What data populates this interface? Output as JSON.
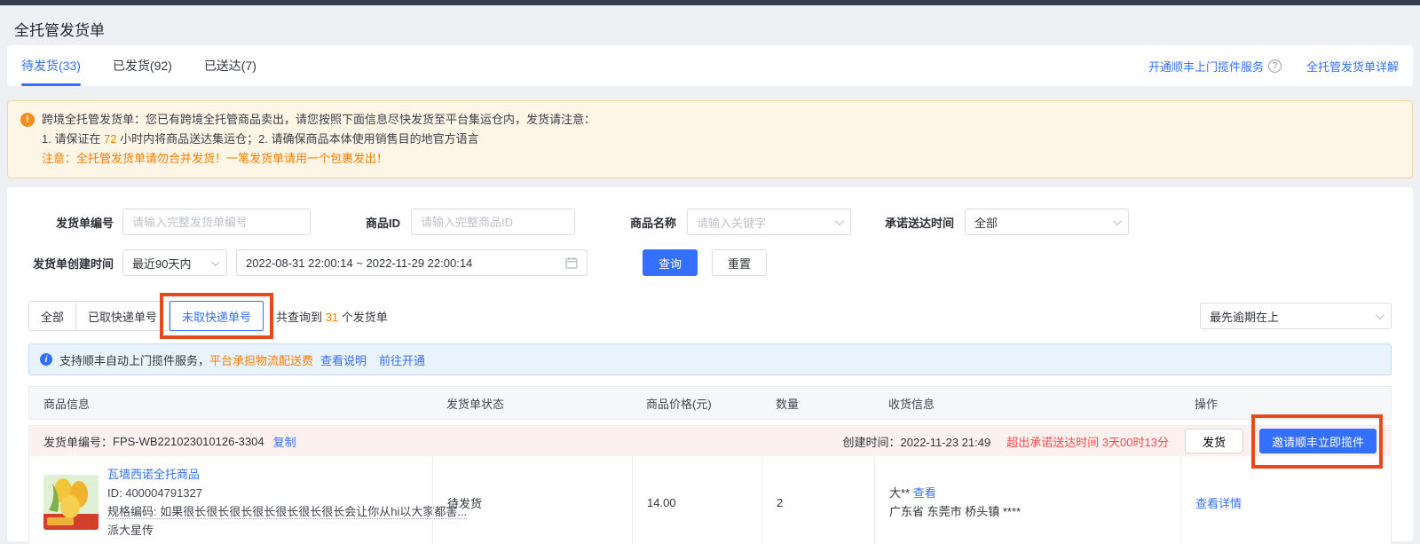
{
  "colors": {
    "accent": "#3370ff",
    "orange": "#fa7d00",
    "danger": "#fb4a4a",
    "annotation": "#e8491c"
  },
  "icons": {
    "help": "?",
    "warning": "!",
    "info": "i"
  },
  "page": {
    "title": "全托管发货单"
  },
  "tabs": [
    {
      "label": "待发货(33)"
    },
    {
      "label": "已发货(92)"
    },
    {
      "label": "已送达(7)"
    }
  ],
  "toplinks": {
    "sf_service": "开通顺丰上门揽件服务",
    "detail": "全托管发货单详解"
  },
  "notice": {
    "line1": "跨境全托管发货单：您已有跨境全托管商品卖出，请您按照下面信息尽快发货至平台集运仓内，发货请注意：",
    "line2_pre": "1. 请保证在 ",
    "line2_hl": "72",
    "line2_post": " 小时内将商品送达集运仓；2. 请确保商品本体使用销售目的地官方语言",
    "line3": "注意：全托管发货单请勿合并发货！一笔发货单请用一个包裹发出！"
  },
  "form": {
    "shipment_no_label": "发货单编号",
    "shipment_no_placeholder": "请输入完整发货单编号",
    "product_id_label": "商品ID",
    "product_id_placeholder": "请输入完整商品ID",
    "product_name_label": "商品名称",
    "product_name_placeholder": "请输入关键字",
    "promise_label": "承诺送达时间",
    "promise_value": "全部",
    "create_time_label": "发货单创建时间",
    "create_preset": "最近90天内",
    "create_range": "2022-08-31 22:00:14 ~ 2022-11-29 22:00:14",
    "search": "查询",
    "reset": "重置"
  },
  "seg": {
    "all": "全部",
    "picked": "已取快递单号",
    "unpicked": "未取快递单号",
    "result_pre": "共查询到 ",
    "result_count": "31",
    "result_post": " 个发货单",
    "sort_value": "最先逾期在上"
  },
  "banner": {
    "text": "支持顺丰自动上门揽件服务，",
    "highlight": "平台承担物流配送费",
    "link1": "查看说明",
    "link2": "前往开通"
  },
  "table": {
    "columns": [
      "商品信息",
      "发货单状态",
      "商品价格(元)",
      "数量",
      "收货信息",
      "操作"
    ]
  },
  "order": {
    "no_label": "发货单编号：",
    "no": "FPS-WB221023010126-3304",
    "copy": "复制",
    "created_label": "创建时间：",
    "created": "2022-11-23 21:49",
    "overdue": "超出承诺送达时间 3天00时13分",
    "ship_btn": "发货",
    "sf_btn": "邀请顺丰立即揽件",
    "product": {
      "name": "瓦墙西诺全托商品",
      "id": "ID: 400004791327",
      "spec": "规格编码: 如果很长很长很长很长很长很长很长会让你从hi以大家都害...",
      "extra": "派大星传",
      "status": "待发货",
      "price": "14.00",
      "qty": "2",
      "receiver": "大**",
      "receiver_link": "查看",
      "address": "广东省 东莞市 桥头镇 ****",
      "action": "查看详情"
    }
  }
}
